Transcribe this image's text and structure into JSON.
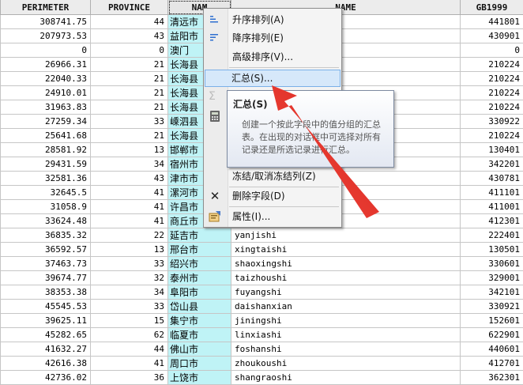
{
  "columns": [
    {
      "label": "PERIMETER"
    },
    {
      "label": "PROVINCE"
    },
    {
      "label": "NAM"
    },
    {
      "label": "NAME"
    },
    {
      "label": "GB1999"
    }
  ],
  "rows": [
    {
      "perimeter": "308741.75",
      "province": "44",
      "name": "清远市",
      "pinyin": "",
      "gb": "441801"
    },
    {
      "perimeter": "207973.53",
      "province": "43",
      "name": "益阳市",
      "pinyin": "",
      "gb": "430901"
    },
    {
      "perimeter": "0",
      "province": "0",
      "name": "澳门",
      "pinyin": "",
      "gb": "0"
    },
    {
      "perimeter": "26966.31",
      "province": "21",
      "name": "长海县",
      "pinyin": "",
      "gb": "210224"
    },
    {
      "perimeter": "22040.33",
      "province": "21",
      "name": "长海县",
      "pinyin": "",
      "gb": "210224"
    },
    {
      "perimeter": "24910.01",
      "province": "21",
      "name": "长海县",
      "pinyin": "",
      "gb": "210224"
    },
    {
      "perimeter": "31963.83",
      "province": "21",
      "name": "长海县",
      "pinyin": "",
      "gb": "210224"
    },
    {
      "perimeter": "27259.34",
      "province": "33",
      "name": "嵊泗县",
      "pinyin": "",
      "gb": "330922"
    },
    {
      "perimeter": "25641.68",
      "province": "21",
      "name": "长海县",
      "pinyin": "",
      "gb": "210224"
    },
    {
      "perimeter": "28581.92",
      "province": "13",
      "name": "邯郸市",
      "pinyin": "",
      "gb": "130401"
    },
    {
      "perimeter": "29431.59",
      "province": "34",
      "name": "宿州市",
      "pinyin": "",
      "gb": "342201"
    },
    {
      "perimeter": "32581.36",
      "province": "43",
      "name": "津市市",
      "pinyin": "",
      "gb": "430781"
    },
    {
      "perimeter": "32645.5",
      "province": "41",
      "name": "漯河市",
      "pinyin": "",
      "gb": "411101"
    },
    {
      "perimeter": "31058.9",
      "province": "41",
      "name": "许昌市",
      "pinyin": "",
      "gb": "411001"
    },
    {
      "perimeter": "33624.48",
      "province": "41",
      "name": "商丘市",
      "pinyin": "",
      "gb": "412301"
    },
    {
      "perimeter": "36835.32",
      "province": "22",
      "name": "延吉市",
      "pinyin": "yanjishi",
      "gb": "222401"
    },
    {
      "perimeter": "36592.57",
      "province": "13",
      "name": "邢台市",
      "pinyin": "xingtaishi",
      "gb": "130501"
    },
    {
      "perimeter": "37463.73",
      "province": "33",
      "name": "绍兴市",
      "pinyin": "shaoxingshi",
      "gb": "330601"
    },
    {
      "perimeter": "39674.77",
      "province": "32",
      "name": "泰州市",
      "pinyin": "taizhoushi",
      "gb": "329001"
    },
    {
      "perimeter": "38353.38",
      "province": "34",
      "name": "阜阳市",
      "pinyin": "fuyangshi",
      "gb": "342101"
    },
    {
      "perimeter": "45545.53",
      "province": "33",
      "name": "岱山县",
      "pinyin": "daishanxian",
      "gb": "330921"
    },
    {
      "perimeter": "39625.11",
      "province": "15",
      "name": "集宁市",
      "pinyin": "jiningshi",
      "gb": "152601"
    },
    {
      "perimeter": "45282.65",
      "province": "62",
      "name": "临夏市",
      "pinyin": "linxiashi",
      "gb": "622901"
    },
    {
      "perimeter": "41632.27",
      "province": "44",
      "name": "佛山市",
      "pinyin": "foshanshi",
      "gb": "440601"
    },
    {
      "perimeter": "42616.38",
      "province": "41",
      "name": "周口市",
      "pinyin": "zhoukoushi",
      "gb": "412701"
    },
    {
      "perimeter": "42736.02",
      "province": "36",
      "name": "上饶市",
      "pinyin": "shangraoshi",
      "gb": "362301"
    }
  ],
  "menu": {
    "sort_asc": "升序排列(A)",
    "sort_desc": "降序排列(E)",
    "advanced_sort": "高级排序(V)...",
    "summarize": "汇总(S)...",
    "freeze": "冻结/取消冻结列(Z)",
    "delete_field": "删除字段(D)",
    "properties": "属性(I)..."
  },
  "tooltip": {
    "title": "汇总(S)",
    "body": "创建一个按此字段中的值分组的汇总表。在出现的对话框中可选择对所有记录还是所选记录进行汇总。"
  },
  "colors": {
    "highlight_column": "#bff3f6",
    "menu_highlight": "#d6e8fa",
    "arrow": "#e8302a"
  }
}
